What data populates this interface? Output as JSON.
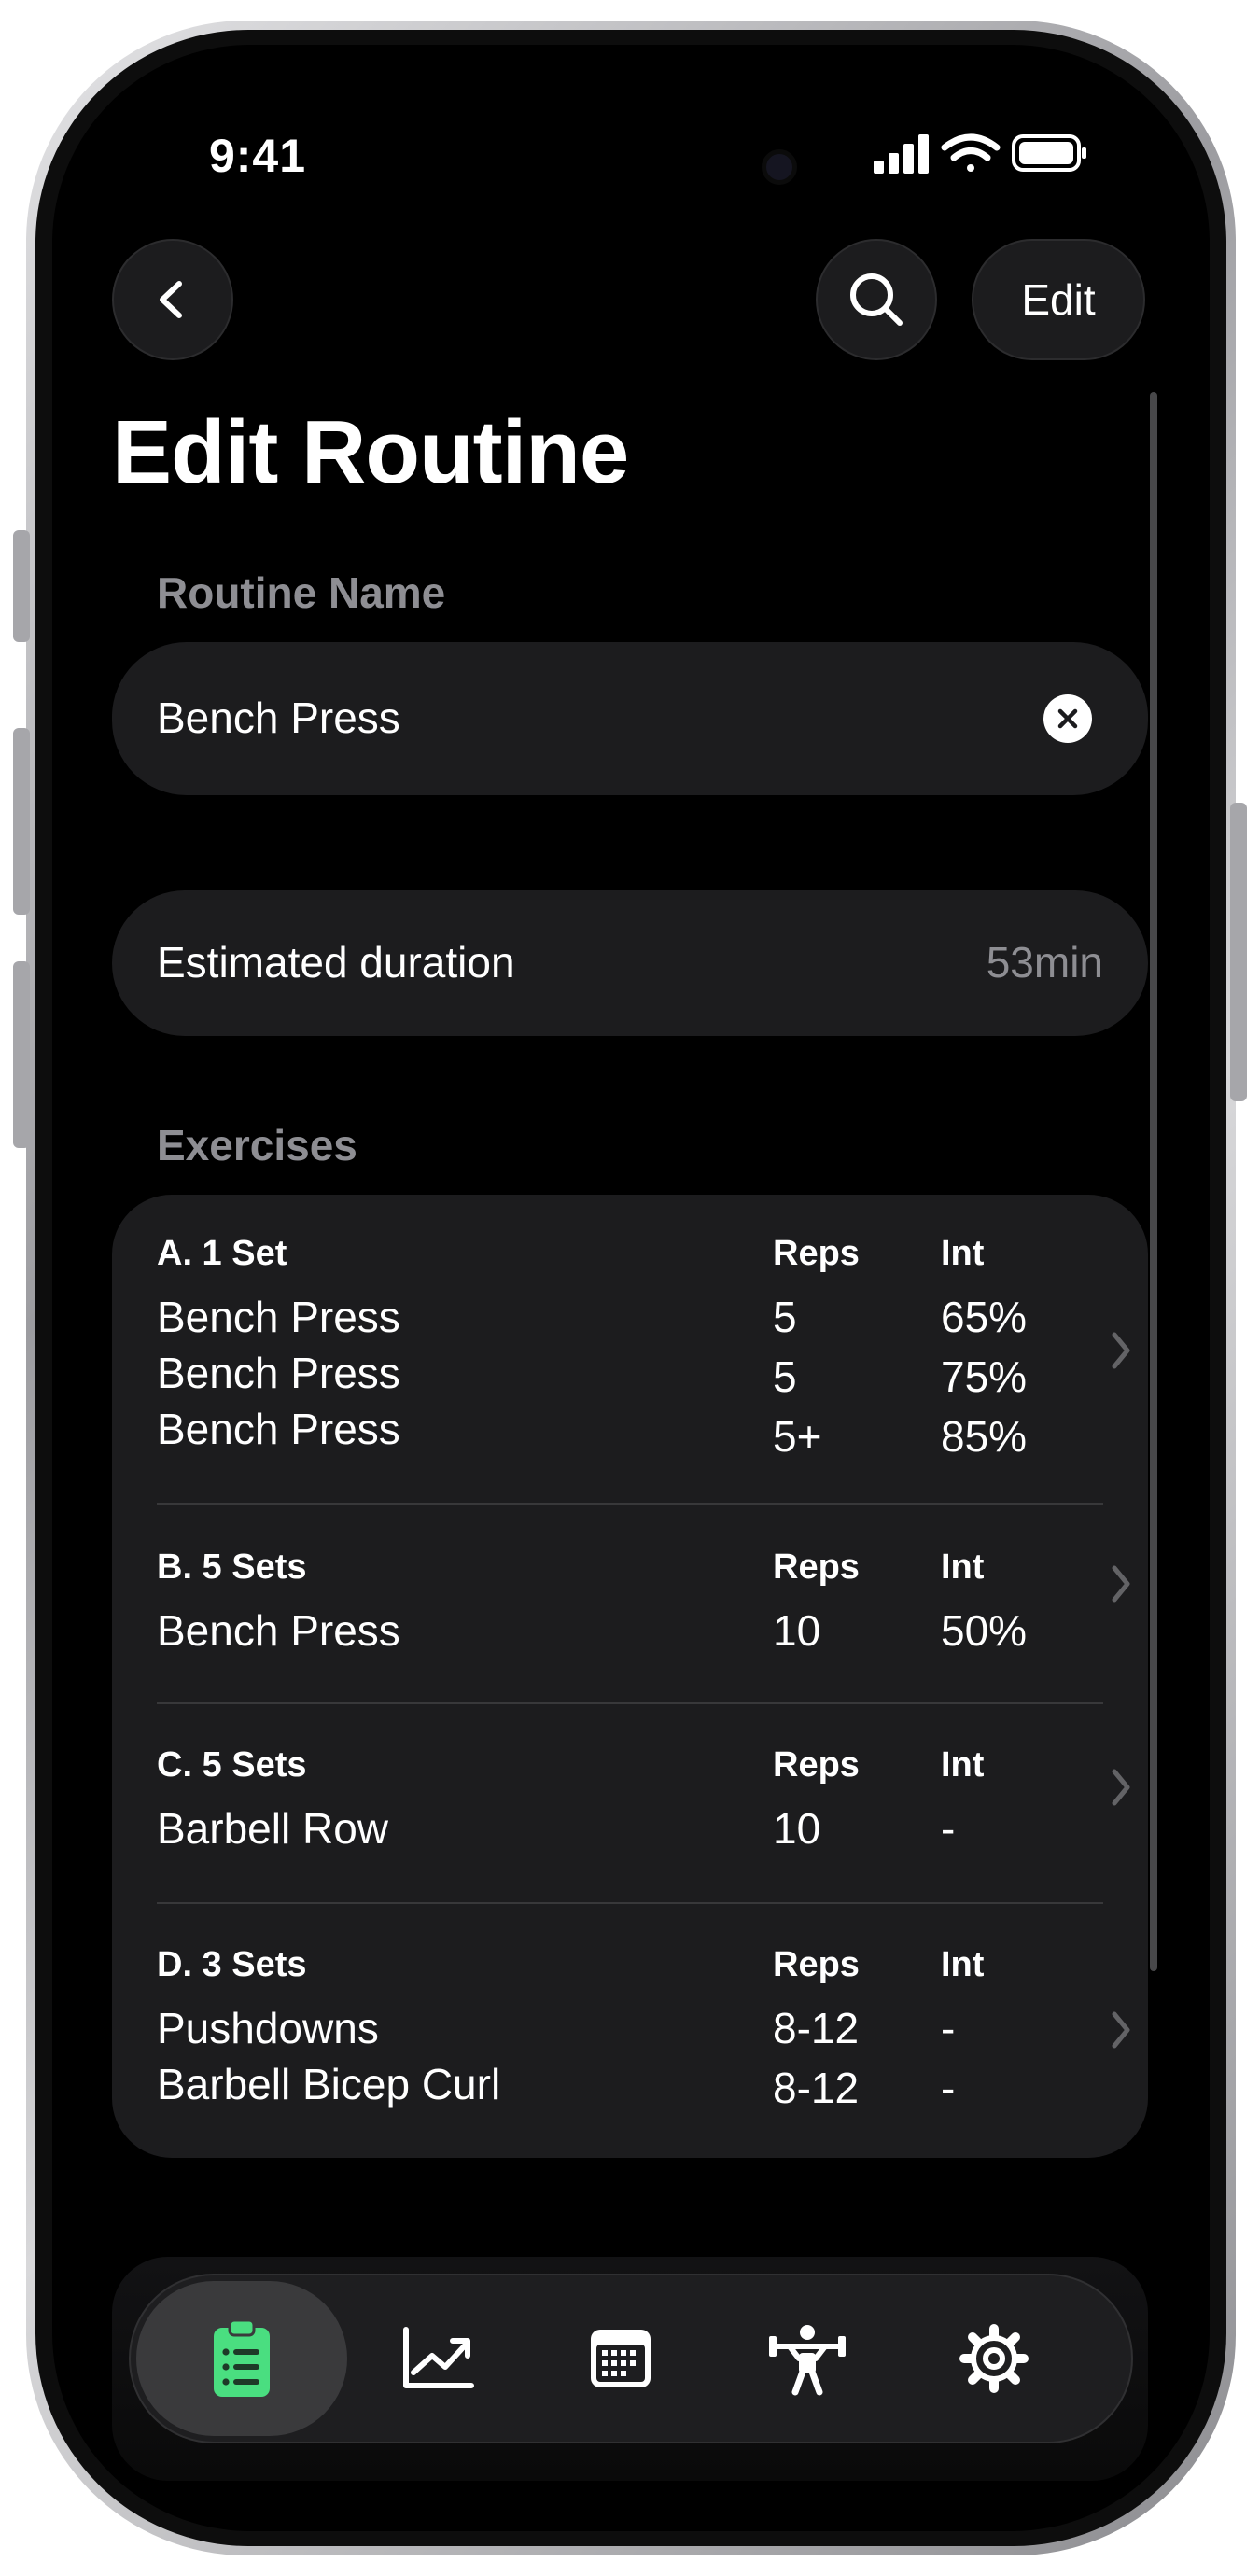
{
  "status_bar": {
    "time": "9:41"
  },
  "header": {
    "back_icon": "chevron-left-icon",
    "search_icon": "search-icon",
    "edit_label": "Edit",
    "title": "Edit Routine"
  },
  "routine_name": {
    "label": "Routine Name",
    "value": "Bench Press",
    "clear_icon": "clear-circle-icon"
  },
  "duration": {
    "label": "Estimated duration",
    "value": "53min"
  },
  "exercises": {
    "label": "Exercises",
    "groups": [
      {
        "set_label": "A. 1 Set",
        "reps_header": "Reps",
        "int_header": "Int",
        "lines": [
          {
            "name": "Bench Press",
            "reps": "5",
            "int": "65%"
          },
          {
            "name": "Bench Press",
            "reps": "5",
            "int": "75%"
          },
          {
            "name": "Bench Press",
            "reps": "5+",
            "int": "85%"
          }
        ]
      },
      {
        "set_label": "B. 5 Sets",
        "reps_header": "Reps",
        "int_header": "Int",
        "lines": [
          {
            "name": "Bench Press",
            "reps": "10",
            "int": "50%"
          }
        ]
      },
      {
        "set_label": "C. 5 Sets",
        "reps_header": "Reps",
        "int_header": "Int",
        "lines": [
          {
            "name": "Barbell Row",
            "reps": "10",
            "int": "-"
          }
        ]
      },
      {
        "set_label": "D. 3 Sets",
        "reps_header": "Reps",
        "int_header": "Int",
        "lines": [
          {
            "name": "Pushdowns",
            "reps": "8-12",
            "int": "-"
          },
          {
            "name": "Barbell Bicep Curl",
            "reps": "8-12",
            "int": "-"
          }
        ]
      }
    ]
  },
  "tab_bar": {
    "tabs": [
      {
        "icon": "clipboard-list-icon",
        "active": true
      },
      {
        "icon": "chart-trend-icon",
        "active": false
      },
      {
        "icon": "calendar-icon",
        "active": false
      },
      {
        "icon": "weightlifter-icon",
        "active": false
      },
      {
        "icon": "gear-icon",
        "active": false
      }
    ],
    "active_color": "#4ade80"
  },
  "colors": {
    "background": "#000000",
    "surface": "#1c1c1e",
    "secondary_text": "#8e8e93",
    "accent": "#4ade80"
  }
}
